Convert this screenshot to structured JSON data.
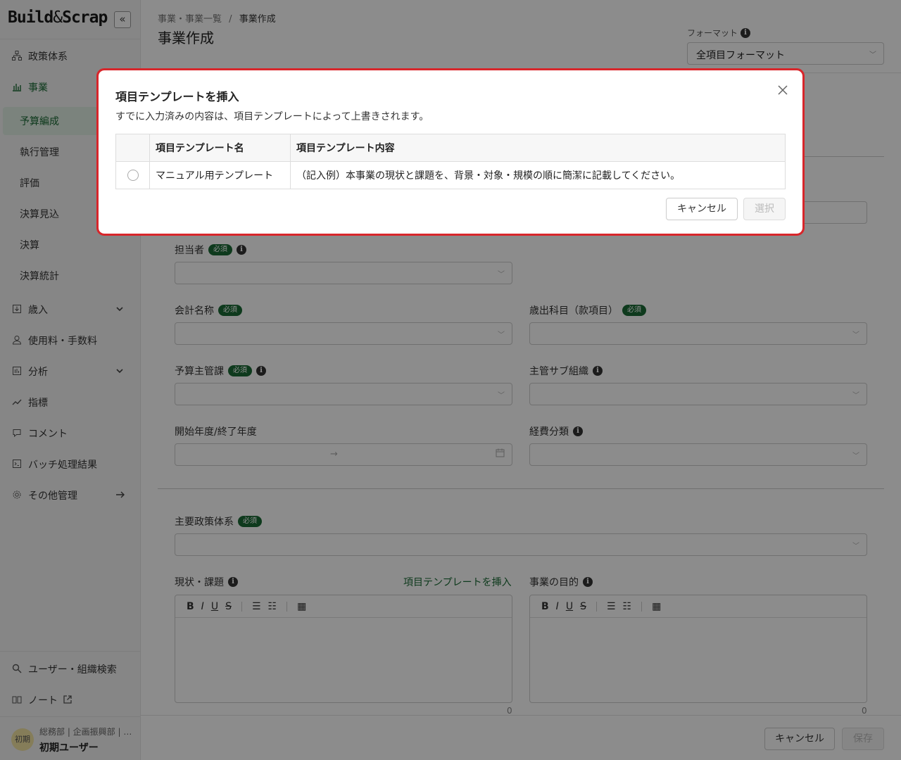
{
  "app": {
    "logo_main": "Build",
    "logo_amp": "&",
    "logo_tail": "Scrap",
    "collapse_glyph": "«"
  },
  "sidebar": {
    "items": [
      {
        "label": "政策体系",
        "icon": "hierarchy-icon"
      },
      {
        "label": "事業",
        "icon": "bar-chart-icon"
      },
      {
        "label": "歳入",
        "icon": "revenue-icon"
      },
      {
        "label": "使用料・手数料",
        "icon": "fee-icon"
      },
      {
        "label": "分析",
        "icon": "analysis-icon"
      },
      {
        "label": "指標",
        "icon": "trend-icon"
      },
      {
        "label": "コメント",
        "icon": "comment-icon"
      },
      {
        "label": "バッチ処理結果",
        "icon": "terminal-icon"
      },
      {
        "label": "その他管理",
        "icon": "gear-icon"
      }
    ],
    "sub_items": [
      "予算編成",
      "執行管理",
      "評価",
      "決算見込",
      "決算",
      "決算統計"
    ],
    "bottom": [
      {
        "label": "ユーザー・組織検索",
        "icon": "search-icon"
      },
      {
        "label": "ノート",
        "icon": "book-icon"
      }
    ],
    "user": {
      "avatar": "初期",
      "dept": "総務部 | 企画振興部 | …",
      "name": "初期ユーザー"
    }
  },
  "header": {
    "breadcrumb_parent": "事業・事業一覧",
    "breadcrumb_sep": "/",
    "breadcrumb_current": "事業作成",
    "title": "事業作成",
    "format_label": "フォーマット",
    "format_value": "全項目フォーマット"
  },
  "form": {
    "required_badge": "必須",
    "person": "担当者",
    "account": "会計名称",
    "expense_item": "歳出科目（款項目）",
    "budget_dept": "予算主管課",
    "sub_org": "主管サブ組織",
    "period": "開始年度/終了年度",
    "cost_class": "経費分類",
    "policy": "主要政策体系",
    "current_issue": "現状・課題",
    "insert_template_link": "項目テンプレートを挿入",
    "purpose": "事業の目的",
    "counter_left": "0",
    "counter_right": "0"
  },
  "footer": {
    "cancel": "キャンセル",
    "save": "保存"
  },
  "modal": {
    "title": "項目テンプレートを挿入",
    "description": "すでに入力済みの内容は、項目テンプレートによって上書きされます。",
    "col_name": "項目テンプレート名",
    "col_content": "項目テンプレート内容",
    "rows": [
      {
        "name": "マニュアル用テンプレート",
        "content": "（記入例）本事業の現状と課題を、背景・対象・規模の順に簡潔に記載してください。"
      }
    ],
    "cancel": "キャンセル",
    "select": "選択"
  },
  "colors": {
    "accent": "#1b6b35",
    "highlight_border": "#d8262b"
  }
}
